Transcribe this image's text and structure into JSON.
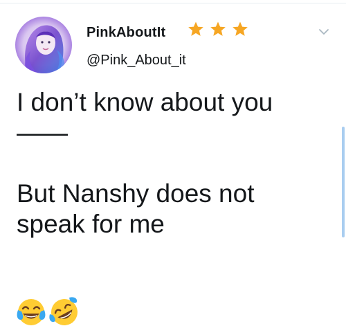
{
  "tweet": {
    "display_name": "PinkAboutIt",
    "handle": "@Pink_About_it",
    "text_lines": [
      "I don’t know about you",
      "——",
      "",
      "But Nanshy does not",
      "speak for me"
    ],
    "emojis": [
      "tears-of-joy-emoji",
      "rolling-on-floor-laughing-emoji"
    ],
    "name_badges": [
      "star-icon",
      "star-icon",
      "star-icon"
    ],
    "menu_icon": "chevron-down-icon"
  },
  "colors": {
    "star": "#f6a623",
    "text": "#14171a",
    "divider": "#e6ecf0",
    "chevron": "#aab8c2",
    "scrollbar": "#a9cdf0"
  }
}
